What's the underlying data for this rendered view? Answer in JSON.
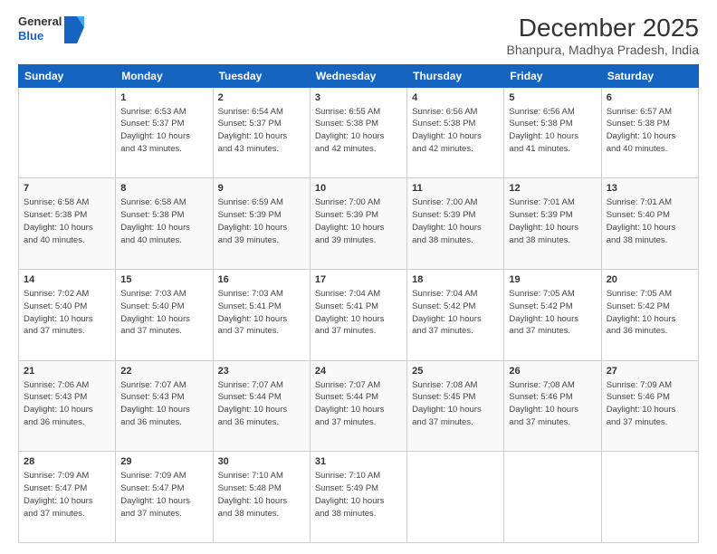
{
  "header": {
    "logo_line1": "General",
    "logo_line2": "Blue",
    "title": "December 2025",
    "subtitle": "Bhanpura, Madhya Pradesh, India"
  },
  "weekdays": [
    "Sunday",
    "Monday",
    "Tuesday",
    "Wednesday",
    "Thursday",
    "Friday",
    "Saturday"
  ],
  "weeks": [
    [
      {
        "day": "",
        "info": ""
      },
      {
        "day": "1",
        "info": "Sunrise: 6:53 AM\nSunset: 5:37 PM\nDaylight: 10 hours\nand 43 minutes."
      },
      {
        "day": "2",
        "info": "Sunrise: 6:54 AM\nSunset: 5:37 PM\nDaylight: 10 hours\nand 43 minutes."
      },
      {
        "day": "3",
        "info": "Sunrise: 6:55 AM\nSunset: 5:38 PM\nDaylight: 10 hours\nand 42 minutes."
      },
      {
        "day": "4",
        "info": "Sunrise: 6:56 AM\nSunset: 5:38 PM\nDaylight: 10 hours\nand 42 minutes."
      },
      {
        "day": "5",
        "info": "Sunrise: 6:56 AM\nSunset: 5:38 PM\nDaylight: 10 hours\nand 41 minutes."
      },
      {
        "day": "6",
        "info": "Sunrise: 6:57 AM\nSunset: 5:38 PM\nDaylight: 10 hours\nand 40 minutes."
      }
    ],
    [
      {
        "day": "7",
        "info": "Sunrise: 6:58 AM\nSunset: 5:38 PM\nDaylight: 10 hours\nand 40 minutes."
      },
      {
        "day": "8",
        "info": "Sunrise: 6:58 AM\nSunset: 5:38 PM\nDaylight: 10 hours\nand 40 minutes."
      },
      {
        "day": "9",
        "info": "Sunrise: 6:59 AM\nSunset: 5:39 PM\nDaylight: 10 hours\nand 39 minutes."
      },
      {
        "day": "10",
        "info": "Sunrise: 7:00 AM\nSunset: 5:39 PM\nDaylight: 10 hours\nand 39 minutes."
      },
      {
        "day": "11",
        "info": "Sunrise: 7:00 AM\nSunset: 5:39 PM\nDaylight: 10 hours\nand 38 minutes."
      },
      {
        "day": "12",
        "info": "Sunrise: 7:01 AM\nSunset: 5:39 PM\nDaylight: 10 hours\nand 38 minutes."
      },
      {
        "day": "13",
        "info": "Sunrise: 7:01 AM\nSunset: 5:40 PM\nDaylight: 10 hours\nand 38 minutes."
      }
    ],
    [
      {
        "day": "14",
        "info": "Sunrise: 7:02 AM\nSunset: 5:40 PM\nDaylight: 10 hours\nand 37 minutes."
      },
      {
        "day": "15",
        "info": "Sunrise: 7:03 AM\nSunset: 5:40 PM\nDaylight: 10 hours\nand 37 minutes."
      },
      {
        "day": "16",
        "info": "Sunrise: 7:03 AM\nSunset: 5:41 PM\nDaylight: 10 hours\nand 37 minutes."
      },
      {
        "day": "17",
        "info": "Sunrise: 7:04 AM\nSunset: 5:41 PM\nDaylight: 10 hours\nand 37 minutes."
      },
      {
        "day": "18",
        "info": "Sunrise: 7:04 AM\nSunset: 5:42 PM\nDaylight: 10 hours\nand 37 minutes."
      },
      {
        "day": "19",
        "info": "Sunrise: 7:05 AM\nSunset: 5:42 PM\nDaylight: 10 hours\nand 37 minutes."
      },
      {
        "day": "20",
        "info": "Sunrise: 7:05 AM\nSunset: 5:42 PM\nDaylight: 10 hours\nand 36 minutes."
      }
    ],
    [
      {
        "day": "21",
        "info": "Sunrise: 7:06 AM\nSunset: 5:43 PM\nDaylight: 10 hours\nand 36 minutes."
      },
      {
        "day": "22",
        "info": "Sunrise: 7:07 AM\nSunset: 5:43 PM\nDaylight: 10 hours\nand 36 minutes."
      },
      {
        "day": "23",
        "info": "Sunrise: 7:07 AM\nSunset: 5:44 PM\nDaylight: 10 hours\nand 36 minutes."
      },
      {
        "day": "24",
        "info": "Sunrise: 7:07 AM\nSunset: 5:44 PM\nDaylight: 10 hours\nand 37 minutes."
      },
      {
        "day": "25",
        "info": "Sunrise: 7:08 AM\nSunset: 5:45 PM\nDaylight: 10 hours\nand 37 minutes."
      },
      {
        "day": "26",
        "info": "Sunrise: 7:08 AM\nSunset: 5:46 PM\nDaylight: 10 hours\nand 37 minutes."
      },
      {
        "day": "27",
        "info": "Sunrise: 7:09 AM\nSunset: 5:46 PM\nDaylight: 10 hours\nand 37 minutes."
      }
    ],
    [
      {
        "day": "28",
        "info": "Sunrise: 7:09 AM\nSunset: 5:47 PM\nDaylight: 10 hours\nand 37 minutes."
      },
      {
        "day": "29",
        "info": "Sunrise: 7:09 AM\nSunset: 5:47 PM\nDaylight: 10 hours\nand 37 minutes."
      },
      {
        "day": "30",
        "info": "Sunrise: 7:10 AM\nSunset: 5:48 PM\nDaylight: 10 hours\nand 38 minutes."
      },
      {
        "day": "31",
        "info": "Sunrise: 7:10 AM\nSunset: 5:49 PM\nDaylight: 10 hours\nand 38 minutes."
      },
      {
        "day": "",
        "info": ""
      },
      {
        "day": "",
        "info": ""
      },
      {
        "day": "",
        "info": ""
      }
    ]
  ]
}
